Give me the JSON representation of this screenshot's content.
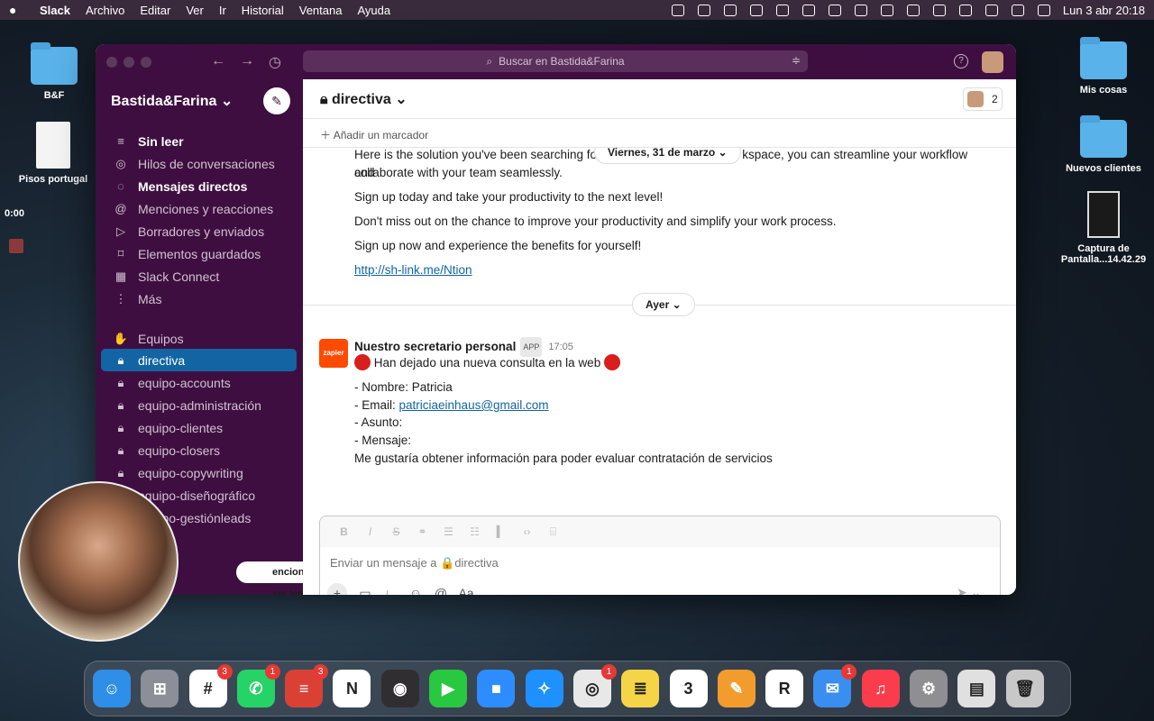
{
  "menubar": {
    "apple": "",
    "items": [
      "Slack",
      "Archivo",
      "Editar",
      "Ver",
      "Ir",
      "Historial",
      "Ventana",
      "Ayuda"
    ],
    "clock": "Lun 3 abr 20:18"
  },
  "desktop": {
    "left_icons": [
      {
        "label": "B&F"
      },
      {
        "label": "Pisos portugal"
      }
    ],
    "right_icons": [
      {
        "label": "Mis cosas"
      },
      {
        "label": "Nuevos clientes"
      },
      {
        "label": "Captura de Pantalla...14.42.29"
      }
    ],
    "timer": "0:00"
  },
  "window": {
    "search_placeholder": "Buscar en Bastida&Farina"
  },
  "sidebar": {
    "workspace": "Bastida&Farina ⌄",
    "nav": [
      {
        "label": "Sin leer",
        "icon": "≡"
      },
      {
        "label": "Hilos de conversaciones",
        "icon": "◎"
      },
      {
        "label": "Mensajes directos",
        "icon": "◌"
      },
      {
        "label": "Menciones y reacciones",
        "icon": "@"
      },
      {
        "label": "Borradores y enviados",
        "icon": "▷"
      },
      {
        "label": "Elementos guardados",
        "icon": "⌑"
      },
      {
        "label": "Slack Connect",
        "icon": "▦"
      },
      {
        "label": "Más",
        "icon": "⋮"
      }
    ],
    "section_label": "Equipos",
    "channels": [
      "directiva",
      "equipo-accounts",
      "equipo-administración",
      "equipo-clientes",
      "equipo-closers",
      "equipo-copywriting",
      "equipo-diseñográfico",
      "equipo-gestiónleads"
    ],
    "unread_pill": "enciones sin leer"
  },
  "channel": {
    "name": "directiva ⌄",
    "member_count": "2",
    "bookmark": "Añadir un marcador"
  },
  "messages": {
    "prev_lines": [
      "Here is the solution you've been searching for.",
      "kspace, you can streamline your workflow and",
      "collaborate with your team seamlessly.",
      "Sign up today and take your productivity to the next level!",
      "Don't miss out on the chance to improve your productivity and simplify your work process.",
      "Sign up now and experience the benefits for yourself!"
    ],
    "prev_link": "http://sh-link.me/Ntion",
    "date_pill_top": "Viernes, 31 de marzo ⌄",
    "date_pill_mid": "Ayer ⌄",
    "zapier": {
      "logo": "zapier",
      "sender": "Nuestro secretario personal",
      "badge": "APP",
      "time": "17:05",
      "headline": "Han dejado una nueva consulta en la web",
      "nombre": "- Nombre: Patricia",
      "email_label": "- Email: ",
      "email": "patriciaeinhaus@gmail.com",
      "asunto": "- Asunto:",
      "mensaje": "- Mensaje:",
      "body": "Me gustaría obtener información para poder evaluar contratación de servicios"
    }
  },
  "composer": {
    "placeholder": "Enviar un mensaje a 🔒directiva",
    "aa": "Aa"
  },
  "dock": {
    "apps": [
      {
        "name": "finder",
        "color": "#2e8ee8",
        "glyph": "☺"
      },
      {
        "name": "launchpad",
        "color": "#8a8f98",
        "glyph": "⊞"
      },
      {
        "name": "slack",
        "color": "#ffffff",
        "glyph": "#",
        "badge": "3"
      },
      {
        "name": "whatsapp",
        "color": "#25d366",
        "glyph": "✆",
        "badge": "1"
      },
      {
        "name": "todoist",
        "color": "#db4035",
        "glyph": "≡",
        "badge": "3"
      },
      {
        "name": "notion",
        "color": "#ffffff",
        "glyph": "N"
      },
      {
        "name": "obs",
        "color": "#302e31",
        "glyph": "◉"
      },
      {
        "name": "facetime",
        "color": "#28c840",
        "glyph": "▶"
      },
      {
        "name": "zoom",
        "color": "#2d8cff",
        "glyph": "■"
      },
      {
        "name": "safari",
        "color": "#1e90ff",
        "glyph": "✧"
      },
      {
        "name": "chrome",
        "color": "#e8e8e8",
        "glyph": "◎",
        "badge": "1"
      },
      {
        "name": "notes",
        "color": "#f5d547",
        "glyph": "≣"
      },
      {
        "name": "calendar",
        "color": "#ffffff",
        "glyph": "3"
      },
      {
        "name": "pages",
        "color": "#f39c2e",
        "glyph": "✎"
      },
      {
        "name": "reeder",
        "color": "#ffffff",
        "glyph": "R"
      },
      {
        "name": "mail",
        "color": "#3a8ef0",
        "glyph": "✉",
        "badge": "1"
      },
      {
        "name": "music",
        "color": "#fa3c4c",
        "glyph": "♫"
      },
      {
        "name": "system-settings",
        "color": "#8e8e93",
        "glyph": "⚙"
      },
      {
        "name": "document",
        "color": "#e0e0e0",
        "glyph": "▤"
      },
      {
        "name": "trash",
        "color": "#c8c8c8",
        "glyph": "🗑"
      }
    ]
  }
}
